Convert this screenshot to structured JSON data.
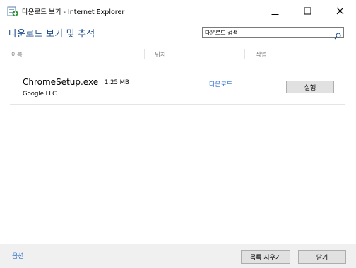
{
  "window": {
    "icon": "ie-download-icon",
    "title": "다운로드 보기 - Internet Explorer",
    "controls": [
      "minimize-icon",
      "maximize-icon",
      "close-icon"
    ]
  },
  "header": {
    "title": "다운로드 보기 및 추적"
  },
  "search": {
    "value": "다운로드 검색",
    "placeholder": "다운로드 검색",
    "icon": "search-icon"
  },
  "columns": {
    "name": "이름",
    "location": "위치",
    "action": "작업"
  },
  "downloads": [
    {
      "name": "ChromeSetup.exe",
      "size": "1.25 MB",
      "publisher": "Google LLC",
      "location": "다운로드",
      "action": "실행"
    }
  ],
  "footer": {
    "options": "옵션",
    "clear_list": "목록 지우기",
    "close": "닫기"
  },
  "colors": {
    "header_title": "#1f4e8c",
    "link": "#2a6ecf",
    "footer_bg": "#f0f0f0"
  }
}
